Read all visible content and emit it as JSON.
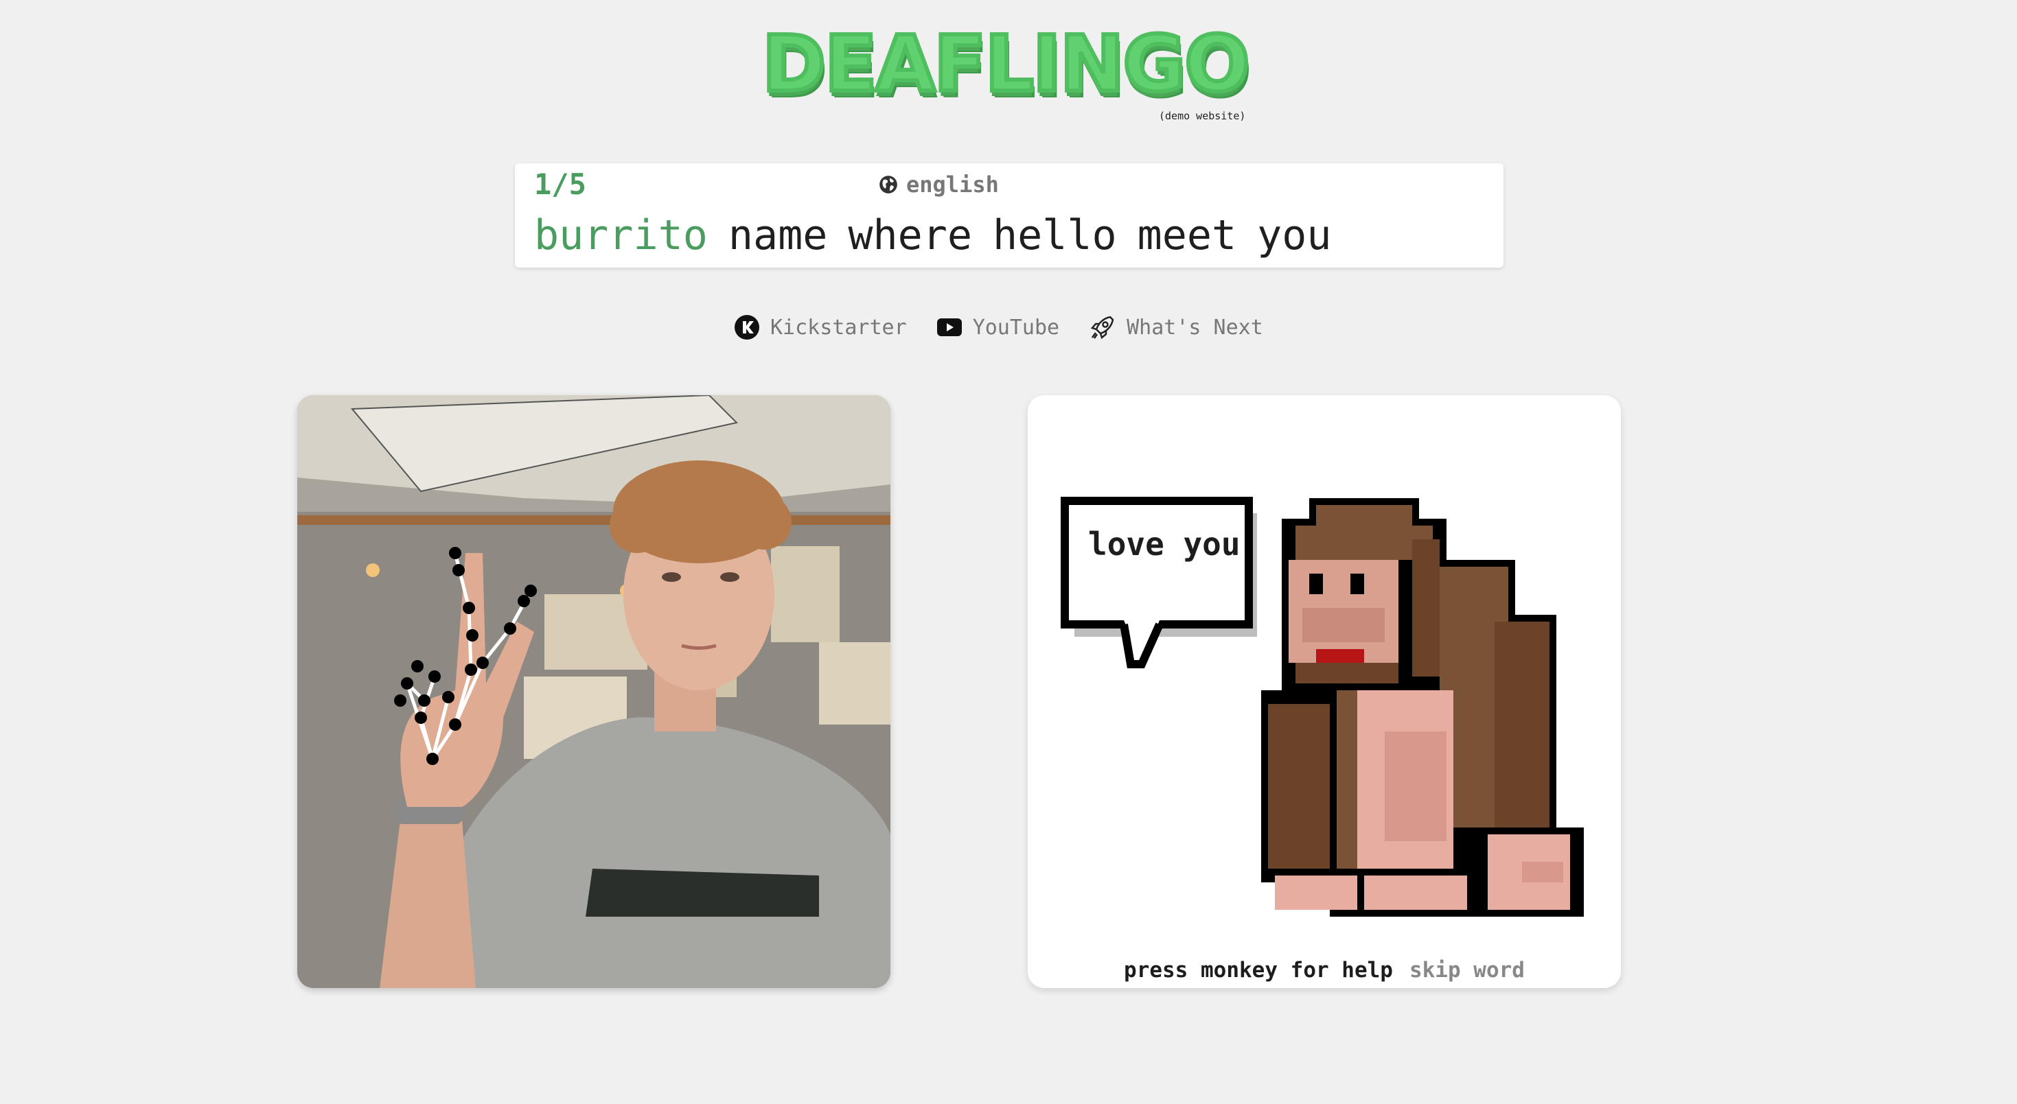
{
  "logo": {
    "title": "DEAFLINGO",
    "subtitle": "(demo website)"
  },
  "lesson": {
    "progress": "1/5",
    "language": "english",
    "words": [
      "burrito",
      "name",
      "where",
      "hello",
      "meet",
      "you"
    ],
    "current_index": 0
  },
  "links": [
    {
      "label": "Kickstarter",
      "icon": "kickstarter-icon"
    },
    {
      "label": "YouTube",
      "icon": "youtube-icon"
    },
    {
      "label": "What's Next",
      "icon": "rocket-icon"
    }
  ],
  "monkey": {
    "speech": "love you",
    "help_label": "press monkey for help",
    "skip_label": "skip word"
  },
  "colors": {
    "accent_green": "#4a9d5f",
    "logo_green": "#5fd16e",
    "background": "#f0f0f0"
  }
}
